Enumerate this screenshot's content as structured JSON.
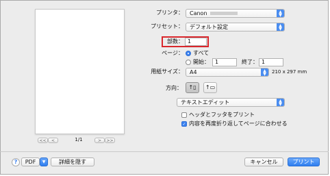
{
  "printer": {
    "label": "プリンタ：",
    "value": "Canon"
  },
  "preset": {
    "label": "プリセット：",
    "value": "デフォルト設定"
  },
  "copies": {
    "label": "部数：",
    "value": "1"
  },
  "pages": {
    "label": "ページ：",
    "all_label": "すべて",
    "from_label": "開始：",
    "from_value": "1",
    "to_label": "終了：",
    "to_value": "1"
  },
  "paper": {
    "label": "用紙サイズ：",
    "value": "A4",
    "dimensions": "210 x 297 mm"
  },
  "orientation": {
    "label": "方向："
  },
  "app_menu": {
    "value": "テキストエディット"
  },
  "options": {
    "header_footer": "ヘッダとフッタをプリント",
    "rewrap": "内容を再度折り返してページに合わせる"
  },
  "preview": {
    "page_count": "1/1",
    "first": "<<",
    "prev": "<",
    "next": ">",
    "last": ">>"
  },
  "footer": {
    "help": "?",
    "pdf": "PDF",
    "details": "詳細を隠す",
    "cancel": "キャンセル",
    "print": "プリント"
  }
}
